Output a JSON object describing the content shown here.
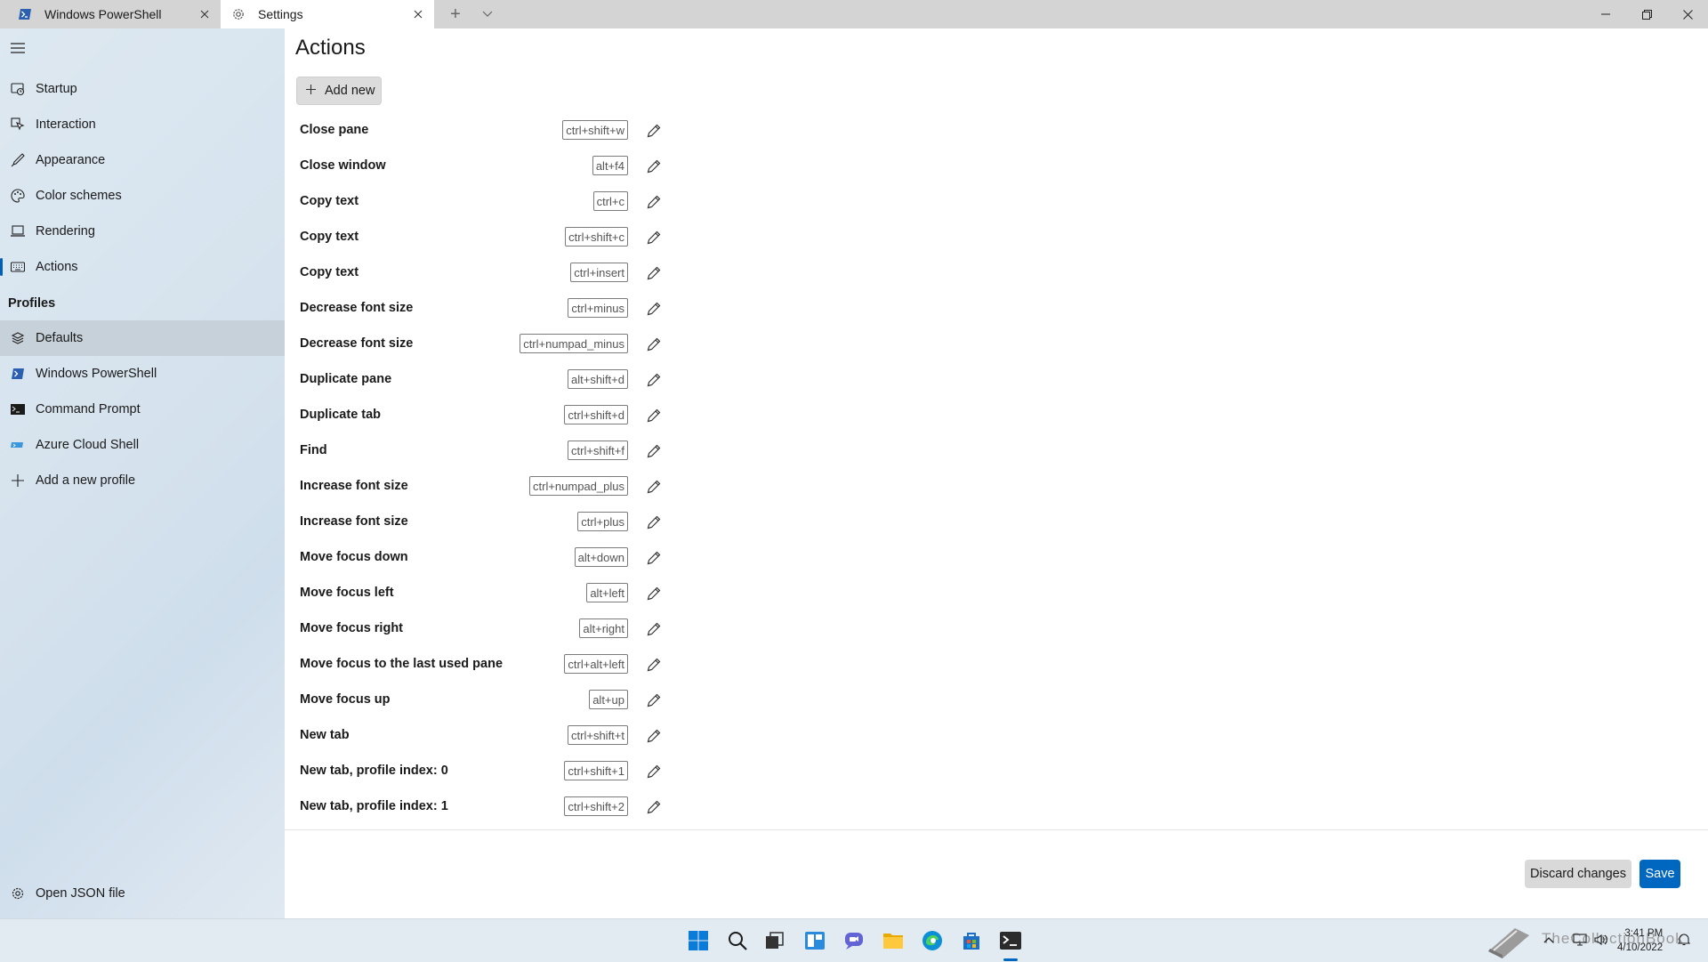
{
  "tabs": [
    {
      "label": "Windows PowerShell"
    },
    {
      "label": "Settings"
    }
  ],
  "window": {
    "new_tab": "+"
  },
  "sidebar": {
    "items": [
      {
        "label": "Startup",
        "icon": "startup-icon"
      },
      {
        "label": "Interaction",
        "icon": "interaction-icon"
      },
      {
        "label": "Appearance",
        "icon": "appearance-icon"
      },
      {
        "label": "Color schemes",
        "icon": "color-schemes-icon"
      },
      {
        "label": "Rendering",
        "icon": "rendering-icon"
      },
      {
        "label": "Actions",
        "icon": "keyboard-icon",
        "selected": true
      }
    ],
    "profiles_header": "Profiles",
    "profiles": [
      {
        "label": "Defaults",
        "icon": "layers-icon"
      },
      {
        "label": "Windows PowerShell",
        "icon": "powershell-icon"
      },
      {
        "label": "Command Prompt",
        "icon": "cmd-icon"
      },
      {
        "label": "Azure Cloud Shell",
        "icon": "azure-icon"
      },
      {
        "label": "Add a new profile",
        "icon": "plus-icon"
      }
    ],
    "open_json": "Open JSON file"
  },
  "main": {
    "title": "Actions",
    "add_new": "Add new",
    "actions": [
      {
        "name": "Close pane",
        "keys": "ctrl+shift+w"
      },
      {
        "name": "Close window",
        "keys": "alt+f4"
      },
      {
        "name": "Copy text",
        "keys": "ctrl+c"
      },
      {
        "name": "Copy text",
        "keys": "ctrl+shift+c"
      },
      {
        "name": "Copy text",
        "keys": "ctrl+insert"
      },
      {
        "name": "Decrease font size",
        "keys": "ctrl+minus"
      },
      {
        "name": "Decrease font size",
        "keys": "ctrl+numpad_minus"
      },
      {
        "name": "Duplicate pane",
        "keys": "alt+shift+d"
      },
      {
        "name": "Duplicate tab",
        "keys": "ctrl+shift+d"
      },
      {
        "name": "Find",
        "keys": "ctrl+shift+f"
      },
      {
        "name": "Increase font size",
        "keys": "ctrl+numpad_plus"
      },
      {
        "name": "Increase font size",
        "keys": "ctrl+plus"
      },
      {
        "name": "Move focus down",
        "keys": "alt+down"
      },
      {
        "name": "Move focus left",
        "keys": "alt+left"
      },
      {
        "name": "Move focus right",
        "keys": "alt+right"
      },
      {
        "name": "Move focus to the last used pane",
        "keys": "ctrl+alt+left"
      },
      {
        "name": "Move focus up",
        "keys": "alt+up"
      },
      {
        "name": "New tab",
        "keys": "ctrl+shift+t"
      },
      {
        "name": "New tab, profile index: 0",
        "keys": "ctrl+shift+1"
      },
      {
        "name": "New tab, profile index: 1",
        "keys": "ctrl+shift+2"
      }
    ]
  },
  "footer": {
    "discard": "Discard changes",
    "save": "Save"
  },
  "taskbar": {
    "time": "3:41 PM",
    "date": "4/10/2022",
    "watermark": "TheCollectionBook"
  },
  "colors": {
    "accent": "#0067c0",
    "sidebar_bg": "#d8e4ee",
    "tabbar_bg": "#d4d4d4"
  }
}
